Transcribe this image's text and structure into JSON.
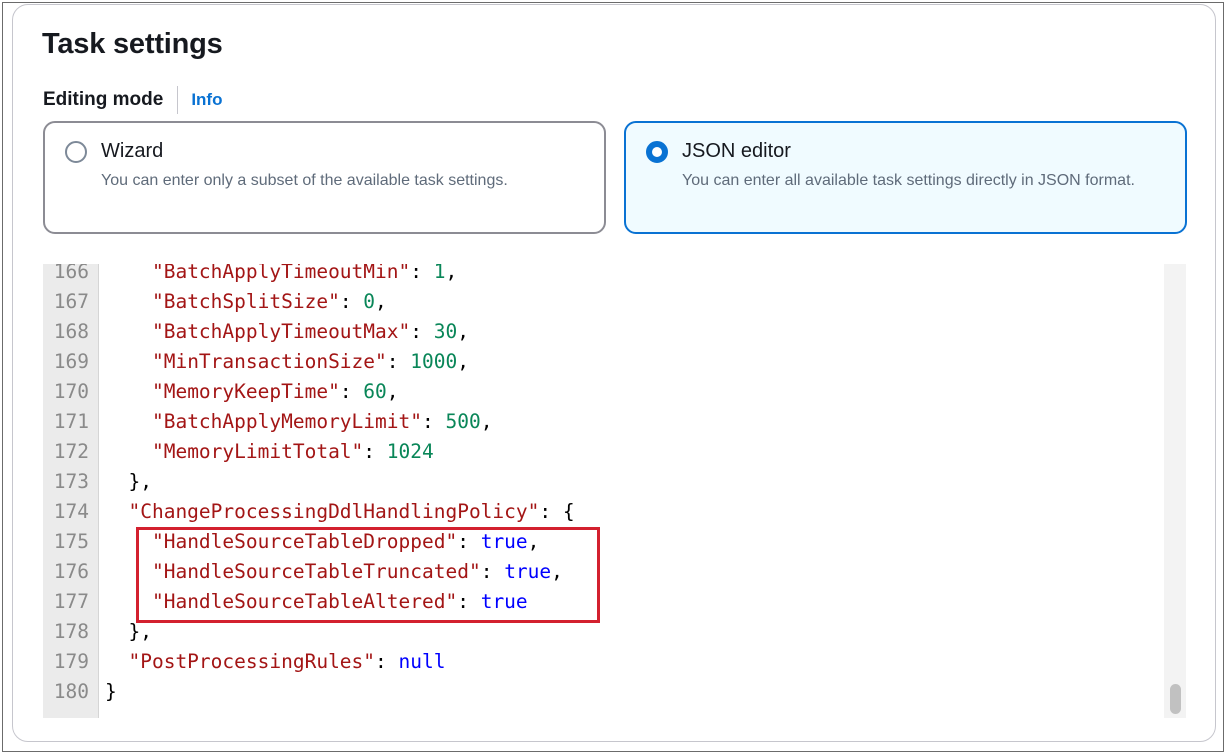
{
  "section": {
    "title": "Task settings"
  },
  "editing_mode": {
    "label": "Editing mode",
    "info_link": "Info"
  },
  "options": [
    {
      "title": "Wizard",
      "description": "You can enter only a subset of the available task settings.",
      "selected": false
    },
    {
      "title": "JSON editor",
      "description": "You can enter all available task settings directly in JSON format.",
      "selected": true
    }
  ],
  "editor": {
    "lines": [
      {
        "num": "166",
        "indent": "    ",
        "key": "\"BatchApplyTimeoutMin\"",
        "sep": ": ",
        "value": "1",
        "vtype": "n",
        "tail": ","
      },
      {
        "num": "167",
        "indent": "    ",
        "key": "\"BatchSplitSize\"",
        "sep": ": ",
        "value": "0",
        "vtype": "n",
        "tail": ","
      },
      {
        "num": "168",
        "indent": "    ",
        "key": "\"BatchApplyTimeoutMax\"",
        "sep": ": ",
        "value": "30",
        "vtype": "n",
        "tail": ","
      },
      {
        "num": "169",
        "indent": "    ",
        "key": "\"MinTransactionSize\"",
        "sep": ": ",
        "value": "1000",
        "vtype": "n",
        "tail": ","
      },
      {
        "num": "170",
        "indent": "    ",
        "key": "\"MemoryKeepTime\"",
        "sep": ": ",
        "value": "60",
        "vtype": "n",
        "tail": ","
      },
      {
        "num": "171",
        "indent": "    ",
        "key": "\"BatchApplyMemoryLimit\"",
        "sep": ": ",
        "value": "500",
        "vtype": "n",
        "tail": ","
      },
      {
        "num": "172",
        "indent": "    ",
        "key": "\"MemoryLimitTotal\"",
        "sep": ": ",
        "value": "1024",
        "vtype": "n",
        "tail": ""
      },
      {
        "num": "173",
        "indent": "  ",
        "key": "",
        "sep": "",
        "value": "",
        "vtype": "p",
        "tail": "},"
      },
      {
        "num": "174",
        "indent": "  ",
        "key": "\"ChangeProcessingDdlHandlingPolicy\"",
        "sep": ": ",
        "value": "",
        "vtype": "p",
        "tail": "{"
      },
      {
        "num": "175",
        "indent": "    ",
        "key": "\"HandleSourceTableDropped\"",
        "sep": ": ",
        "value": "true",
        "vtype": "b",
        "tail": ","
      },
      {
        "num": "176",
        "indent": "    ",
        "key": "\"HandleSourceTableTruncated\"",
        "sep": ": ",
        "value": "true",
        "vtype": "b",
        "tail": ","
      },
      {
        "num": "177",
        "indent": "    ",
        "key": "\"HandleSourceTableAltered\"",
        "sep": ": ",
        "value": "true",
        "vtype": "b",
        "tail": ""
      },
      {
        "num": "178",
        "indent": "  ",
        "key": "",
        "sep": "",
        "value": "",
        "vtype": "p",
        "tail": "},"
      },
      {
        "num": "179",
        "indent": "  ",
        "key": "\"PostProcessingRules\"",
        "sep": ": ",
        "value": "null",
        "vtype": "b",
        "tail": ""
      },
      {
        "num": "180",
        "indent": "",
        "key": "",
        "sep": "",
        "value": "",
        "vtype": "p",
        "tail": "}"
      }
    ]
  },
  "colors": {
    "accent": "#0972d3",
    "selected_tile_bg": "#f0fbff",
    "json_key": "#a31515",
    "json_number": "#098658",
    "json_literal": "#0000ff",
    "highlight_box": "#d3202f"
  }
}
